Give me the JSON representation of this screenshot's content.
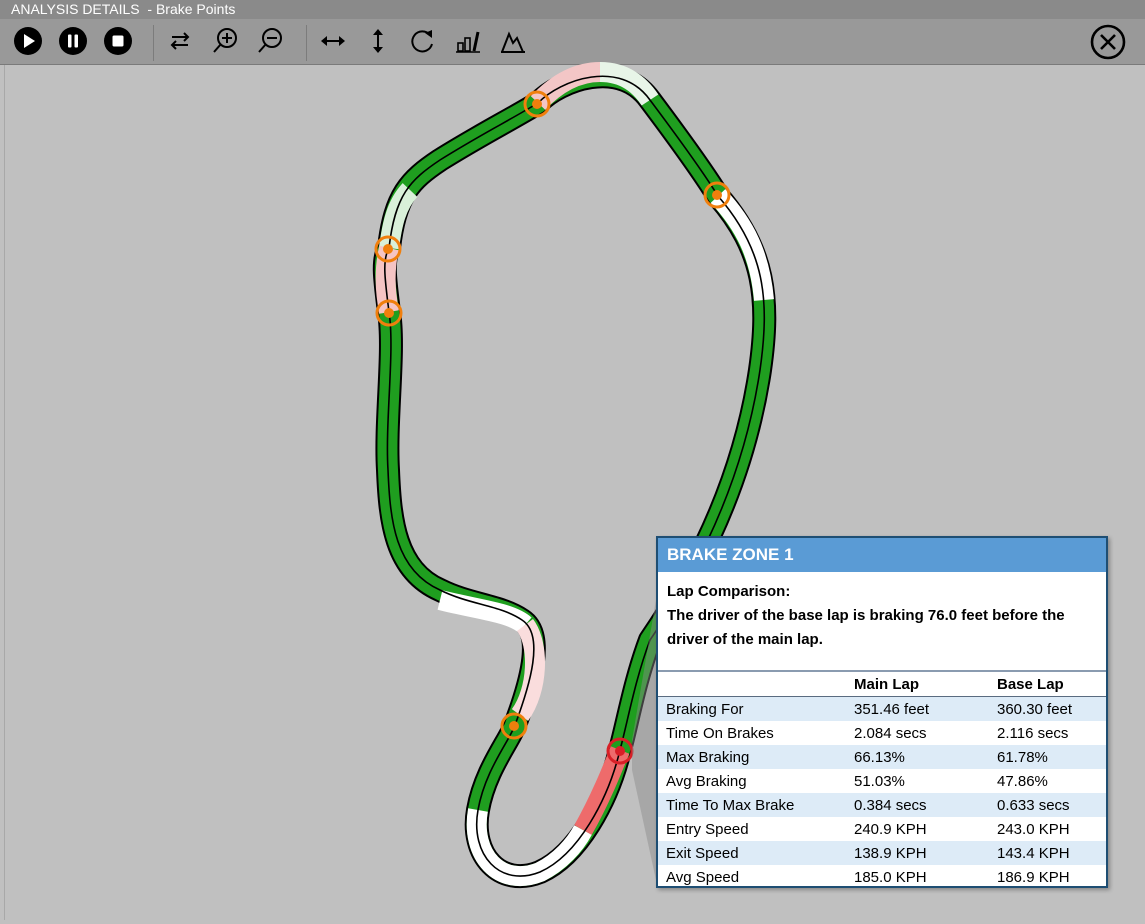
{
  "window": {
    "title": "ANALYSIS DETAILS  - Brake Points"
  },
  "toolbar": {
    "buttons": [
      "play-icon",
      "pause-icon",
      "stop-icon",
      "swap-icon",
      "zoom-in-icon",
      "zoom-out-icon",
      "expand-horizontal-icon",
      "expand-vertical-icon",
      "rotate-icon",
      "bar-chart-icon",
      "peak-chart-icon"
    ],
    "close": "close-icon"
  },
  "colors": {
    "track_green": "#1f9e1f",
    "track_outline": "#000000",
    "brake_marker": "#f07f0d",
    "selected_marker": "#d81f26",
    "panel_header": "#5a9bd5",
    "row_alt": "#ddebf7"
  },
  "brake_zone": {
    "title": "BRAKE ZONE 1",
    "comparison_heading": "Lap Comparison:",
    "comparison_text": "The driver of the base lap is braking 76.0 feet before the driver of the main lap.",
    "columns": [
      "",
      "Main Lap",
      "Base Lap"
    ],
    "rows": [
      {
        "label": "Braking For",
        "main": "351.46 feet",
        "base": "360.30 feet"
      },
      {
        "label": "Time On Brakes",
        "main": "2.084 secs",
        "base": "2.116 secs"
      },
      {
        "label": "Max Braking",
        "main": "66.13%",
        "base": "61.78%"
      },
      {
        "label": "Avg Braking",
        "main": "51.03%",
        "base": "47.86%"
      },
      {
        "label": "Time To Max Brake",
        "main": "0.384 secs",
        "base": "0.633 secs"
      },
      {
        "label": "Entry Speed",
        "main": "240.9 KPH",
        "base": "243.0 KPH"
      },
      {
        "label": "Exit Speed",
        "main": "138.9 KPH",
        "base": "143.4 KPH"
      },
      {
        "label": "Avg Speed",
        "main": "185.0 KPH",
        "base": "186.9 KPH"
      }
    ]
  }
}
